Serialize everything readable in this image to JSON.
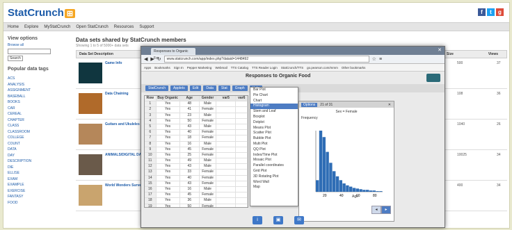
{
  "header": {
    "logo_text": "StatCrunch",
    "logo_badge": "⊞"
  },
  "social": [
    "f",
    "t",
    "g"
  ],
  "topnav": [
    "Home",
    "Explore",
    "MyStatCrunch",
    "Open StatCrunch",
    "Resources",
    "Support"
  ],
  "sidebar": {
    "title": "View options",
    "search_label": "Browse all",
    "search_placeholder": "",
    "search_button": "Search",
    "tags_title": "Popular data tags",
    "tags": [
      "ACS",
      "ANALYSIS",
      "ASSIGNMENT",
      "BASEBALL",
      "BOOKS",
      "CAR",
      "CEREAL",
      "CHAPTER",
      "CLASS",
      "CLASSROOM",
      "COLLEGE",
      "COUNT",
      "DATA",
      "DAY",
      "DESCRIPTION",
      "DIE",
      "ELLISE",
      "EXAM",
      "EXAMPLE",
      "EXERCISE",
      "FANTASY",
      "FOOD"
    ]
  },
  "main": {
    "title": "Data sets shared by StatCrunch members",
    "subtitle": "Showing 1 to 5 of 5000+ data sets",
    "columns": [
      "Data Set Description",
      "Size",
      "Views"
    ],
    "rows": [
      {
        "title": "Game Info",
        "size": "500",
        "views": "37"
      },
      {
        "title": "Data Chaining",
        "size": "108",
        "views": "36"
      },
      {
        "title": "Guitars and Ukuleles and Sold",
        "size": "1040",
        "views": "26"
      },
      {
        "title": "ANIMALS/DIGITAL DATA",
        "size": "10025",
        "views": "34"
      },
      {
        "title": "World Wonders Survey Data",
        "size": "400",
        "views": "34"
      }
    ]
  },
  "window": {
    "tab_title": "Responses to Organic Fo...",
    "url": "www.statcrunch.com/app/index.php?dataid=1448492",
    "bookmarks": [
      "Apps",
      "Bookmarks",
      "Sign In",
      "Pepper Marketing",
      "Webmail",
      "TTS Catalog",
      "TTS Reader Login",
      "StatCrunch/TTS",
      "go.pearson.com/mmm",
      "Other bookmarks"
    ],
    "app_title": "Responses to Organic Food",
    "toolbar": [
      "StatCrunch",
      "Applets",
      "Edit",
      "Data",
      "Stat",
      "Graph",
      "Help"
    ],
    "grid_header": [
      "Row",
      "Buy Organic",
      "Age",
      "Gender",
      "var5",
      "var6"
    ],
    "grid_rows": [
      [
        "1",
        "Yes",
        "48",
        "Male"
      ],
      [
        "2",
        "Yes",
        "41",
        "Female"
      ],
      [
        "3",
        "Yes",
        "23",
        "Male"
      ],
      [
        "4",
        "Yes",
        "50",
        "Female"
      ],
      [
        "5",
        "Yes",
        "43",
        "Male"
      ],
      [
        "6",
        "Yes",
        "40",
        "Female"
      ],
      [
        "7",
        "Yes",
        "18",
        "Female"
      ],
      [
        "8",
        "Yes",
        "16",
        "Male"
      ],
      [
        "9",
        "Yes",
        "45",
        "Female"
      ],
      [
        "10",
        "Yes",
        "25",
        "Female"
      ],
      [
        "11",
        "Yes",
        "49",
        "Male"
      ],
      [
        "12",
        "Yes",
        "43",
        "Male"
      ],
      [
        "13",
        "Yes",
        "33",
        "Female"
      ],
      [
        "14",
        "Yes",
        "40",
        "Female"
      ],
      [
        "15",
        "Yes",
        "43",
        "Female"
      ],
      [
        "16",
        "Yes",
        "16",
        "Male"
      ],
      [
        "17",
        "Yes",
        "45",
        "Female"
      ],
      [
        "18",
        "Yes",
        "36",
        "Male"
      ],
      [
        "19",
        "Yes",
        "50",
        "Female"
      ],
      [
        "20",
        "Yes",
        "27",
        "Male"
      ],
      [
        "21",
        "Yes",
        "21",
        "Female"
      ],
      [
        "22",
        "Yes",
        "46",
        "Male"
      ]
    ],
    "graph_menu": [
      "Bar Plot",
      "Pie Chart",
      "Chart",
      "Histogram",
      "Stem and Leaf",
      "Boxplot",
      "Dotplot",
      "Means Plot",
      "Scatter Plot",
      "Bubble Plot",
      "Multi Plot",
      "QQ Plot",
      "Index/Time Plot",
      "Mosaic Plot",
      "Parallel coordinates",
      "Grid Plot",
      "3D Rotating Plot",
      "Word Wall",
      "Map"
    ],
    "selected_menu_index": 3,
    "plot": {
      "options_label": "Options",
      "pager": "21 of 31",
      "title": "Sex = Female",
      "ylabel": "Frequency",
      "xlabel": "Age",
      "xticks": [
        "20",
        "40",
        "60",
        "80"
      ]
    }
  },
  "chart_data": {
    "type": "bar",
    "title": "Sex = Female",
    "xlabel": "Age",
    "ylabel": "Frequency",
    "categories": [
      "15",
      "18",
      "21",
      "24",
      "27",
      "30",
      "33",
      "36",
      "39",
      "42",
      "45",
      "48",
      "51",
      "54",
      "57",
      "60",
      "63",
      "66",
      "69",
      "72"
    ],
    "values": [
      18,
      95,
      85,
      62,
      45,
      32,
      24,
      18,
      13,
      10,
      8,
      6,
      5,
      4,
      3,
      3,
      2,
      2,
      1,
      1
    ]
  }
}
